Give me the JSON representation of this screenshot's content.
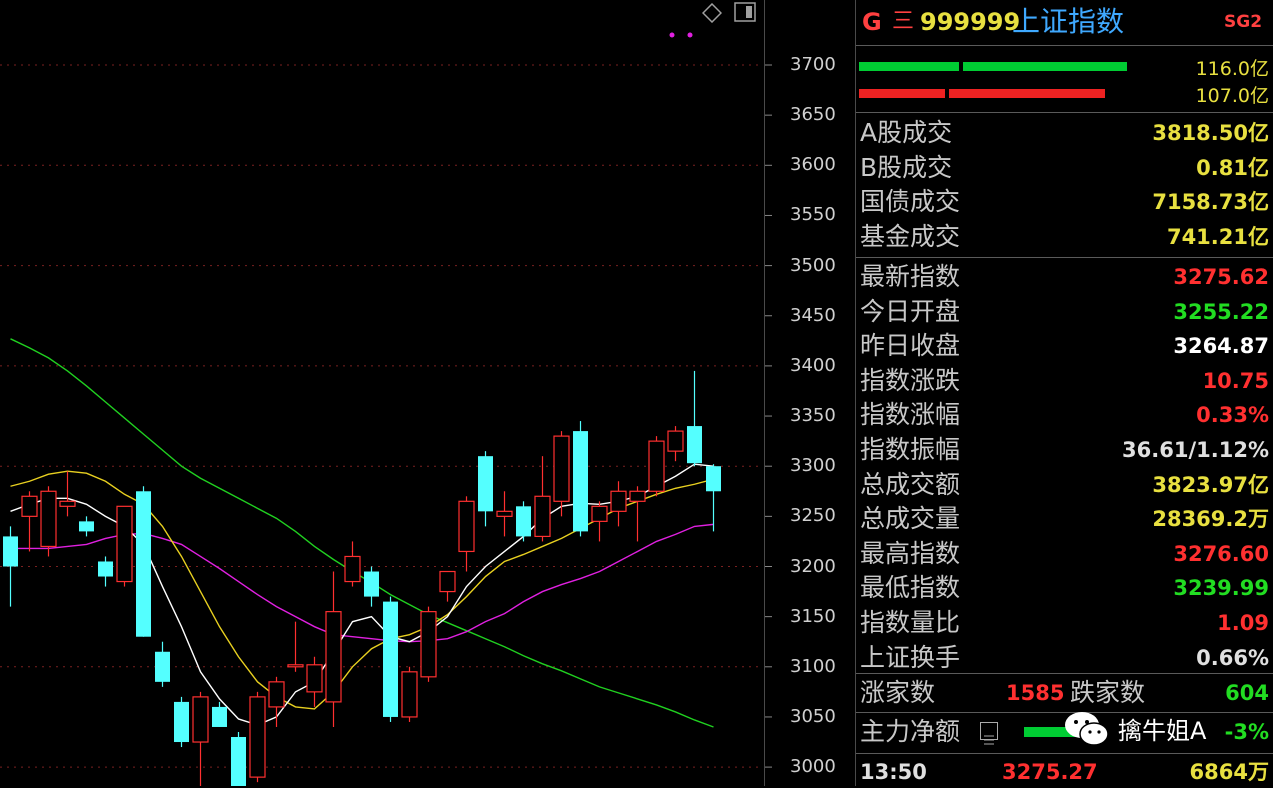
{
  "stock": {
    "prefix_g": "G",
    "menu_glyph": "三",
    "code": "999999",
    "name": "上证指数",
    "tag": "SG2"
  },
  "power_bars": {
    "buy_value": "116.0亿",
    "sell_value": "107.0亿",
    "buy_color": "#00cc33",
    "sell_color": "#ee2222"
  },
  "turnover": [
    {
      "label": "A股成交",
      "value": "3818.50亿",
      "color": "#e8e040"
    },
    {
      "label": "B股成交",
      "value": "0.81亿",
      "color": "#e8e040"
    },
    {
      "label": "国债成交",
      "value": "7158.73亿",
      "color": "#e8e040"
    },
    {
      "label": "基金成交",
      "value": "741.21亿",
      "color": "#e8e040"
    }
  ],
  "quotes": [
    {
      "label": "最新指数",
      "value": "3275.62",
      "color": "#ff3030"
    },
    {
      "label": "今日开盘",
      "value": "3255.22",
      "color": "#22dd22"
    },
    {
      "label": "昨日收盘",
      "value": "3264.87",
      "color": "#ffffff"
    },
    {
      "label": "指数涨跌",
      "value": "10.75",
      "color": "#ff3030"
    },
    {
      "label": "指数涨幅",
      "value": "0.33%",
      "color": "#ff3030"
    },
    {
      "label": "指数振幅",
      "value": "36.61/1.12%",
      "color": "#e0e0e0"
    },
    {
      "label": "总成交额",
      "value": "3823.97亿",
      "color": "#e8e040"
    },
    {
      "label": "总成交量",
      "value": "28369.2万",
      "color": "#e8e040"
    },
    {
      "label": "最高指数",
      "value": "3276.60",
      "color": "#ff3030"
    },
    {
      "label": "最低指数",
      "value": "3239.99",
      "color": "#22dd22"
    },
    {
      "label": "指数量比",
      "value": "1.09",
      "color": "#ff3030"
    },
    {
      "label": "上证换手",
      "value": "0.66%",
      "color": "#e0e0e0"
    }
  ],
  "breadth": {
    "up_label": "涨家数",
    "up_value": "1585",
    "down_label": "跌家数",
    "down_value": "604"
  },
  "main_force": {
    "label": "主力净额",
    "value": "-3%"
  },
  "last_tick": {
    "time": "13:50",
    "price": "3275.27",
    "volume": "6864万"
  },
  "watermark": {
    "text": "擒牛姐A"
  },
  "colors": {
    "up": "#ff3030",
    "down": "#54ffff",
    "ma_short": "#ffffff",
    "ma_mid": "#e8d020",
    "ma_long": "#e020e0",
    "ma_longest": "#20d020",
    "grid": "#7a2020"
  },
  "chart_data": {
    "type": "candlestick",
    "y_axis_ticks": [
      "3700",
      "3650",
      "3600",
      "3550",
      "3500",
      "3450",
      "3400",
      "3350",
      "3300",
      "3250",
      "3200",
      "3150",
      "3100",
      "3050",
      "3000"
    ],
    "ylim": [
      3000,
      3700
    ],
    "candles": [
      {
        "o": 3230,
        "h": 3240,
        "l": 3160,
        "c": 3200
      },
      {
        "o": 3250,
        "h": 3275,
        "l": 3215,
        "c": 3270
      },
      {
        "o": 3220,
        "h": 3280,
        "l": 3210,
        "c": 3275
      },
      {
        "o": 3260,
        "h": 3295,
        "l": 3250,
        "c": 3265
      },
      {
        "o": 3245,
        "h": 3250,
        "l": 3230,
        "c": 3235
      },
      {
        "o": 3205,
        "h": 3210,
        "l": 3180,
        "c": 3190
      },
      {
        "o": 3185,
        "h": 3260,
        "l": 3180,
        "c": 3260
      },
      {
        "o": 3275,
        "h": 3280,
        "l": 3130,
        "c": 3130
      },
      {
        "o": 3115,
        "h": 3125,
        "l": 3080,
        "c": 3085
      },
      {
        "o": 3065,
        "h": 3070,
        "l": 3020,
        "c": 3025
      },
      {
        "o": 3025,
        "h": 3075,
        "l": 2980,
        "c": 3070
      },
      {
        "o": 3060,
        "h": 3065,
        "l": 3040,
        "c": 3040
      },
      {
        "o": 3030,
        "h": 3035,
        "l": 2970,
        "c": 2975
      },
      {
        "o": 2990,
        "h": 3075,
        "l": 2985,
        "c": 3070
      },
      {
        "o": 3060,
        "h": 3090,
        "l": 3040,
        "c": 3085
      },
      {
        "o": 3100,
        "h": 3145,
        "l": 3095,
        "c": 3102
      },
      {
        "o": 3075,
        "h": 3110,
        "l": 3060,
        "c": 3102
      },
      {
        "o": 3065,
        "h": 3195,
        "l": 3040,
        "c": 3155
      },
      {
        "o": 3185,
        "h": 3225,
        "l": 3180,
        "c": 3210
      },
      {
        "o": 3195,
        "h": 3200,
        "l": 3160,
        "c": 3170
      },
      {
        "o": 3165,
        "h": 3170,
        "l": 3045,
        "c": 3050
      },
      {
        "o": 3050,
        "h": 3100,
        "l": 3045,
        "c": 3095
      },
      {
        "o": 3090,
        "h": 3160,
        "l": 3085,
        "c": 3155
      },
      {
        "o": 3175,
        "h": 3195,
        "l": 3165,
        "c": 3195
      },
      {
        "o": 3215,
        "h": 3270,
        "l": 3195,
        "c": 3265
      },
      {
        "o": 3310,
        "h": 3315,
        "l": 3240,
        "c": 3255
      },
      {
        "o": 3250,
        "h": 3275,
        "l": 3230,
        "c": 3255
      },
      {
        "o": 3260,
        "h": 3265,
        "l": 3225,
        "c": 3230
      },
      {
        "o": 3230,
        "h": 3310,
        "l": 3225,
        "c": 3270
      },
      {
        "o": 3265,
        "h": 3335,
        "l": 3250,
        "c": 3330
      },
      {
        "o": 3335,
        "h": 3345,
        "l": 3230,
        "c": 3235
      },
      {
        "o": 3245,
        "h": 3265,
        "l": 3225,
        "c": 3260
      },
      {
        "o": 3255,
        "h": 3285,
        "l": 3240,
        "c": 3275
      },
      {
        "o": 3265,
        "h": 3280,
        "l": 3225,
        "c": 3275
      },
      {
        "o": 3275,
        "h": 3330,
        "l": 3270,
        "c": 3325
      },
      {
        "o": 3315,
        "h": 3340,
        "l": 3305,
        "c": 3335
      },
      {
        "o": 3340,
        "h": 3395,
        "l": 3300,
        "c": 3303
      },
      {
        "o": 3300,
        "h": 3302,
        "l": 3235,
        "c": 3275
      }
    ],
    "ma_short": [
      3255,
      3262,
      3268,
      3268,
      3262,
      3250,
      3240,
      3222,
      3180,
      3140,
      3095,
      3068,
      3048,
      3042,
      3050,
      3075,
      3085,
      3115,
      3145,
      3150,
      3130,
      3125,
      3135,
      3150,
      3180,
      3200,
      3215,
      3230,
      3248,
      3260,
      3263,
      3262,
      3265,
      3270,
      3280,
      3290,
      3302,
      3300
    ],
    "ma_mid": [
      3280,
      3285,
      3292,
      3295,
      3293,
      3285,
      3272,
      3262,
      3240,
      3210,
      3175,
      3140,
      3110,
      3085,
      3070,
      3060,
      3058,
      3075,
      3100,
      3118,
      3128,
      3132,
      3140,
      3152,
      3170,
      3190,
      3205,
      3212,
      3220,
      3228,
      3238,
      3248,
      3258,
      3265,
      3272,
      3278,
      3282,
      3287
    ],
    "ma_long": [
      3218,
      3218,
      3218,
      3220,
      3222,
      3228,
      3232,
      3233,
      3228,
      3222,
      3210,
      3198,
      3185,
      3172,
      3160,
      3150,
      3140,
      3132,
      3130,
      3128,
      3126,
      3125,
      3126,
      3128,
      3135,
      3145,
      3153,
      3165,
      3175,
      3182,
      3188,
      3195,
      3205,
      3215,
      3225,
      3232,
      3240,
      3242
    ],
    "ma_longest": [
      3427,
      3418,
      3408,
      3395,
      3380,
      3364,
      3348,
      3332,
      3316,
      3300,
      3288,
      3278,
      3268,
      3258,
      3248,
      3235,
      3220,
      3207,
      3195,
      3184,
      3172,
      3162,
      3152,
      3144,
      3136,
      3128,
      3120,
      3111,
      3103,
      3096,
      3088,
      3080,
      3074,
      3068,
      3062,
      3055,
      3047,
      3040
    ]
  }
}
